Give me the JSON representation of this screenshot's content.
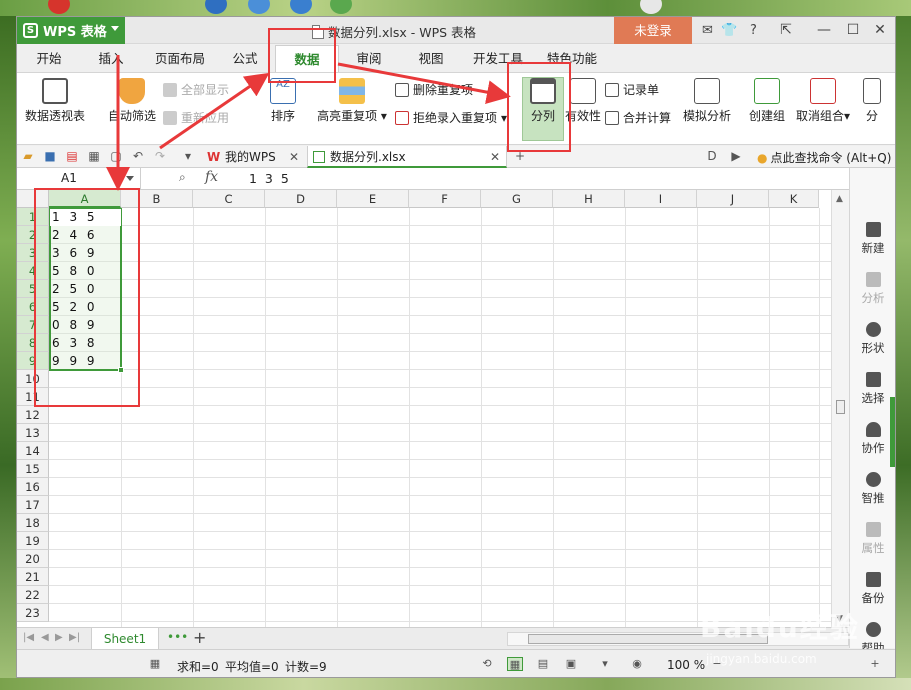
{
  "window": {
    "app_name": "WPS 表格",
    "title": "数据分列.xlsx - WPS 表格",
    "login_label": "未登录"
  },
  "menu_tabs": [
    "开始",
    "插入",
    "页面布局",
    "公式",
    "数据",
    "审阅",
    "视图",
    "开发工具",
    "特色功能"
  ],
  "active_tab": "数据",
  "ribbon": {
    "pivot": "数据透视表",
    "autofilter": "自动筛选",
    "show_all": "全部显示",
    "reapply": "重新应用",
    "sort": "排序",
    "highlight_dup": "高亮重复项",
    "delete_dup": "删除重复项",
    "reject_dup": "拒绝录入重复项",
    "split": "分列",
    "validity": "有效性",
    "record": "记录单",
    "consolidate": "合并计算",
    "what_if": "模拟分析",
    "group": "创建组",
    "ungroup": "取消组合",
    "subtotal": "分"
  },
  "doc_tabs": {
    "mywps": "我的WPS",
    "file": "数据分列.xlsx",
    "find_cmd": "点此查找命令 (Alt+Q)"
  },
  "formula_bar": {
    "name_box": "A1",
    "fx": "fx",
    "value": "1 3 5"
  },
  "columns": [
    "A",
    "B",
    "C",
    "D",
    "E",
    "F",
    "G",
    "H",
    "I",
    "J",
    "K"
  ],
  "rows": [
    "1",
    "2",
    "3",
    "4",
    "5",
    "6",
    "7",
    "8",
    "9",
    "10",
    "11",
    "12",
    "13",
    "14",
    "15",
    "16",
    "17",
    "18",
    "19",
    "20",
    "21",
    "22",
    "23"
  ],
  "cells_a": [
    "1 3 5",
    "2 4 6",
    "3 6 9",
    "5 8 0",
    "2 5 0",
    "5 2 0",
    "0 8 9",
    "6 3 8",
    "9 9 9"
  ],
  "sidebar": [
    "新建",
    "分析",
    "形状",
    "选择",
    "协作",
    "智推",
    "属性",
    "备份",
    "帮助"
  ],
  "sheet_tab": "Sheet1",
  "status": {
    "sum": "求和=0",
    "avg": "平均值=0",
    "count": "计数=9",
    "zoom": "100 %"
  },
  "watermark": {
    "logo": "Baidu经验",
    "url": "jingyan.baidu.com"
  },
  "colors": {
    "accent_green": "#3f9a3a",
    "login_orange": "#e07a55",
    "annotation_red": "#e8393a"
  }
}
